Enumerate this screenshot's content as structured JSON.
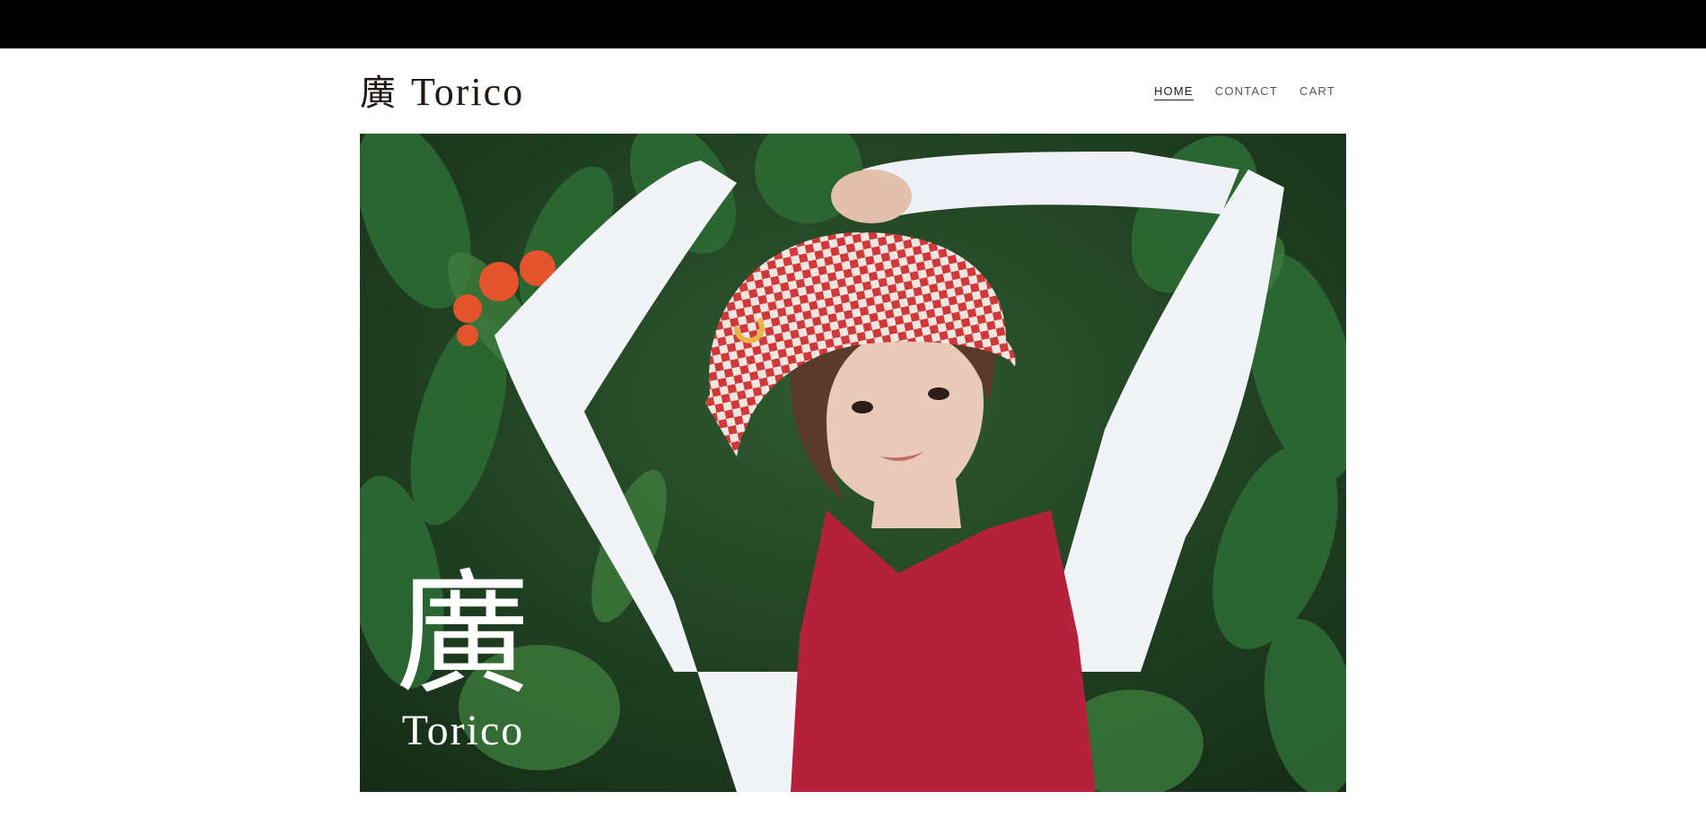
{
  "header": {
    "logo_kanji": "廣",
    "logo_latin": "Torico"
  },
  "nav": {
    "items": [
      {
        "label": "HOME",
        "active": true
      },
      {
        "label": "CONTACT",
        "active": false
      },
      {
        "label": "CART",
        "active": false
      }
    ]
  },
  "hero": {
    "logo_kanji": "廣",
    "logo_latin": "Torico",
    "colors": {
      "foliage": "#1f4a26",
      "shirt": "#f2f3f7",
      "dress": "#b3223a",
      "hat_red": "#d2373a",
      "hat_white": "#efe6e0",
      "skin": "#e9c9b8",
      "hair": "#5a3a28",
      "flower": "#e4532c"
    }
  }
}
